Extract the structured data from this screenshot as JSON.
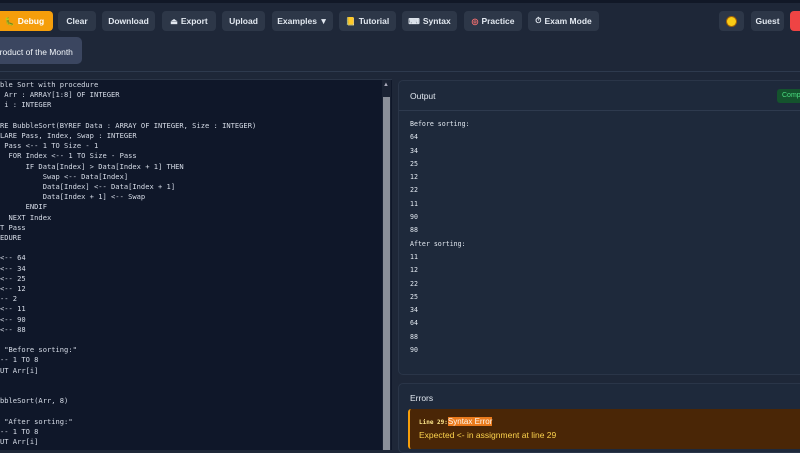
{
  "toolbar": {
    "debug": "Debug",
    "clear": "Clear",
    "download": "Download",
    "export": "Export",
    "upload": "Upload",
    "examples": "Examples ▼",
    "tutorial": "Tutorial",
    "syntax": "Syntax",
    "practice": "Practice",
    "exam_mode": "Exam Mode",
    "guest": "Guest"
  },
  "icons": {
    "debug": "bug-icon",
    "export": "export-icon",
    "tutorial": "book-icon",
    "syntax": "keyboard-icon",
    "practice": "target-icon",
    "exam_mode": "stopwatch-icon",
    "theme": "sun-icon"
  },
  "promo": {
    "small": "r",
    "title": "Product of the Month"
  },
  "editor": {
    "code": "ble Sort with procedure\n Arr : ARRAY[1:8] OF INTEGER\n i : INTEGER\n\nRE BubbleSort(BYREF Data : ARRAY OF INTEGER, Size : INTEGER)\nLARE Pass, Index, Swap : INTEGER\n Pass <-- 1 TO Size - 1\n  FOR Index <-- 1 TO Size - Pass\n      IF Data[Index] > Data[Index + 1] THEN\n          Swap <-- Data[Index]\n          Data[Index] <-- Data[Index + 1]\n          Data[Index + 1] <-- Swap\n      ENDIF\n  NEXT Index\nT Pass\nEDURE\n\n<-- 64\n<-- 34\n<-- 25\n<-- 12\n-- 2\n<-- 11\n<-- 90\n<-- 88\n\n \"Before sorting:\"\n-- 1 TO 8\nUT Arr[i]\n\n\nbbleSort(Arr, 8)\n\n \"After sorting:\"\n-- 1 TO 8\nUT Arr[i]"
  },
  "output": {
    "title": "Output",
    "status": "Comp",
    "lines": [
      "Before sorting:",
      "64",
      "34",
      "25",
      "12",
      "22",
      "11",
      "90",
      "88",
      "After sorting:",
      "11",
      "12",
      "22",
      "25",
      "34",
      "64",
      "88",
      "90"
    ]
  },
  "errors": {
    "title": "Errors",
    "line_label": "Line 29:",
    "type": "Syntax Error",
    "message": "Expected <- in assignment at line 29"
  },
  "colors": {
    "accent": "#f59e0b",
    "success": "#4ade80",
    "error_bg": "#4a2606",
    "danger": "#ef4444"
  }
}
